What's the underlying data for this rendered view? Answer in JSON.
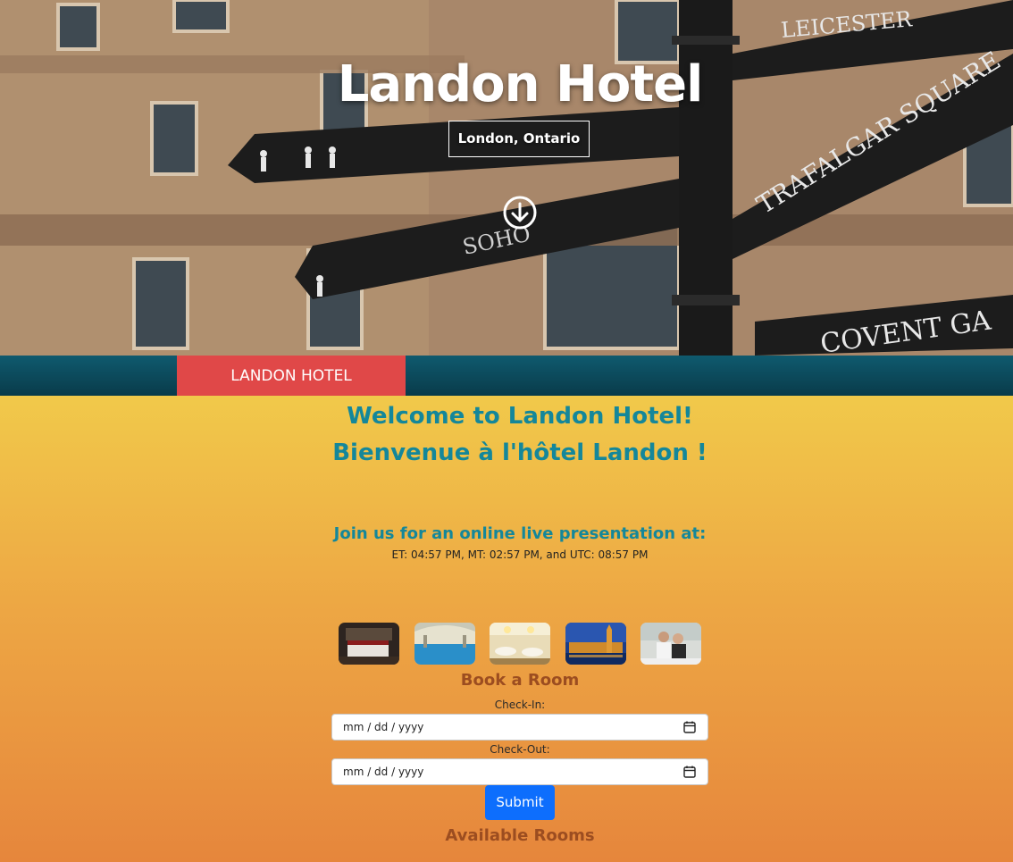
{
  "hero": {
    "title": "Landon Hotel",
    "subtitle": "London, Ontario",
    "signs": [
      "LEICESTER",
      "TRAFALGAR SQUARE",
      "SOHO",
      "COVENT GA"
    ]
  },
  "nav": {
    "brand": "LANDON HOTEL",
    "colors": {
      "bar": "#0b4a5c",
      "brand_bg": "#e04848"
    }
  },
  "main": {
    "welcome_en": "Welcome to Landon Hotel!",
    "welcome_fr": "Bienvenue à l'hôtel Landon !",
    "presentation_heading": "Join us for an online live presentation at:",
    "presentation_times": "ET: 04:57 PM, MT: 02:57 PM, and UTC: 08:57 PM",
    "gallery": [
      "bedroom-photo",
      "pool-photo",
      "restaurant-photo",
      "parliament-photo",
      "couple-photo"
    ]
  },
  "booking": {
    "title": "Book a Room",
    "check_in_label": "Check-In:",
    "check_in_value": "mm / dd / yyyy",
    "check_out_label": "Check-Out:",
    "check_out_value": "mm / dd / yyyy",
    "submit_label": "Submit"
  },
  "rooms": {
    "title": "Available Rooms"
  }
}
